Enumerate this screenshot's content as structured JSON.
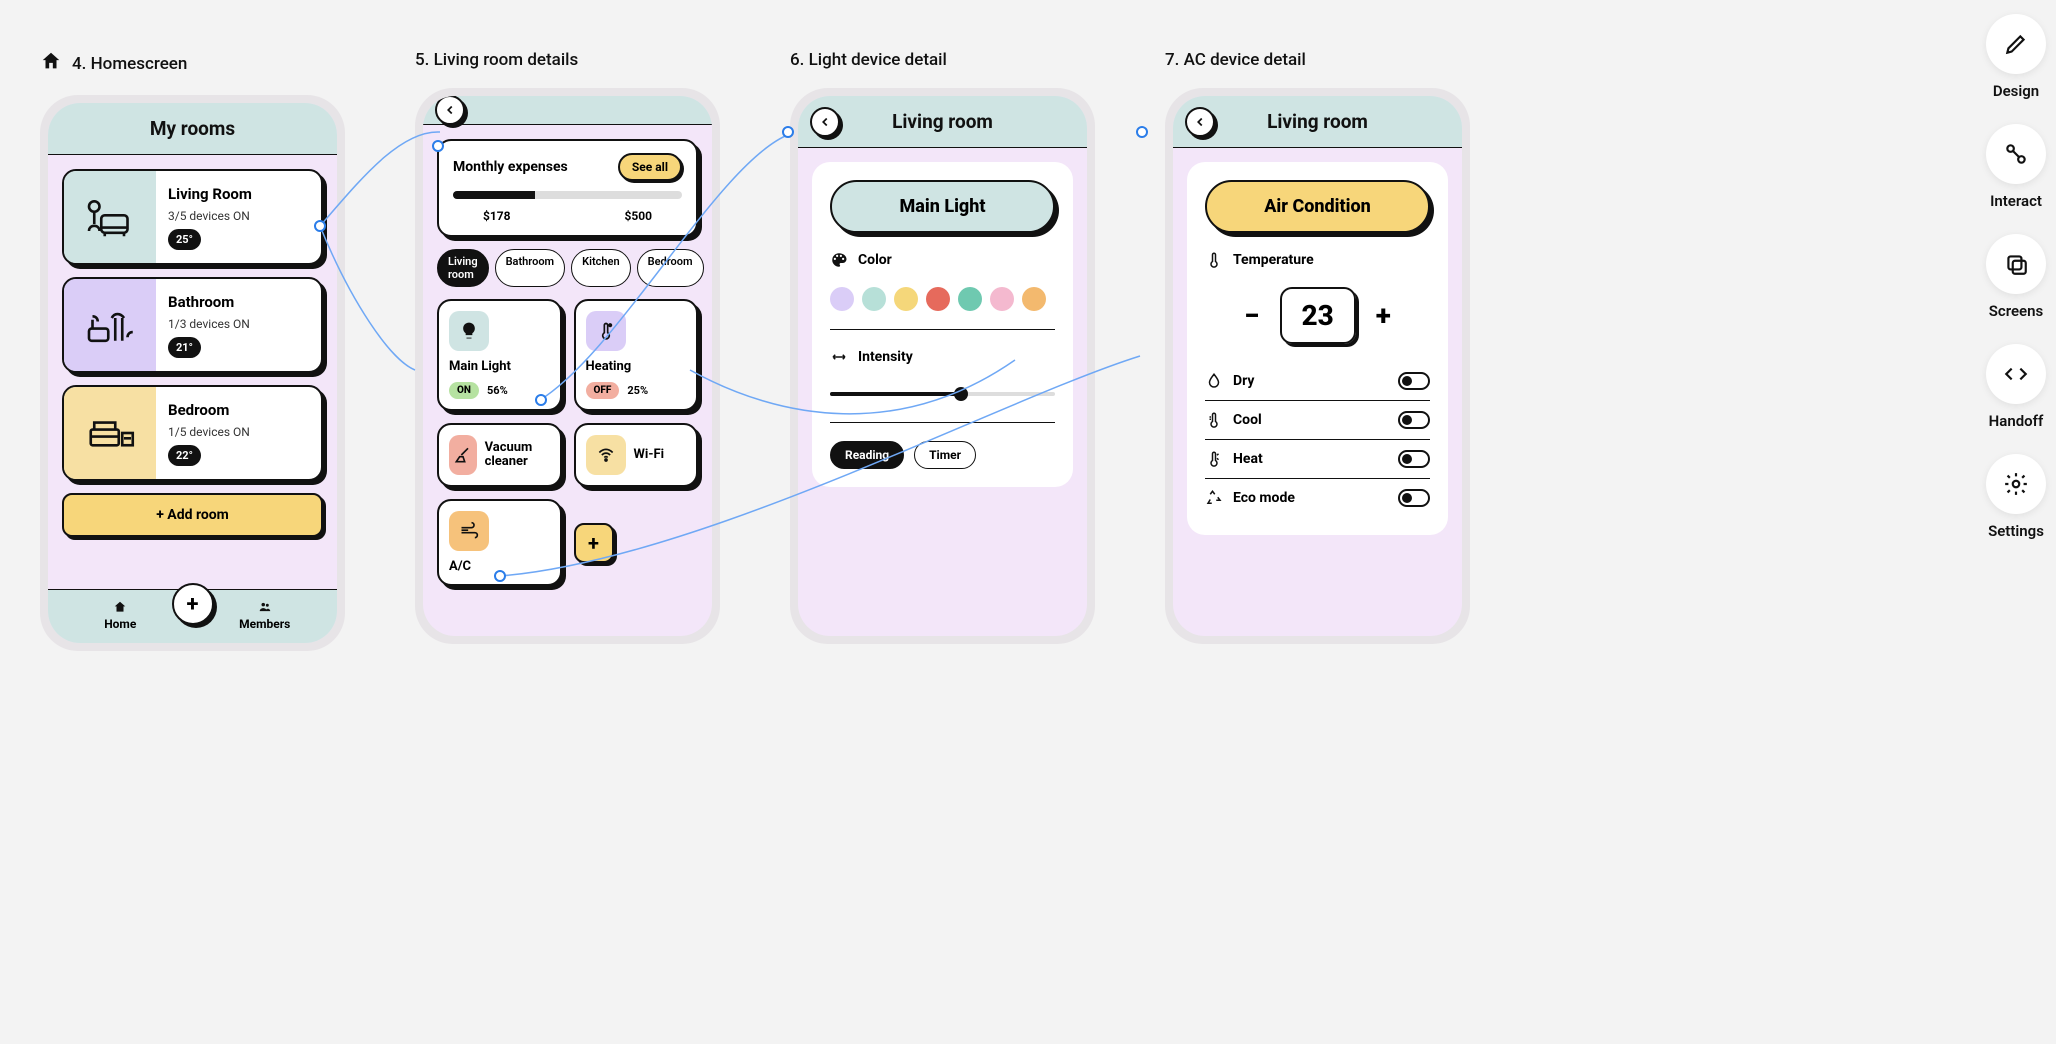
{
  "toolbar": [
    {
      "label": "Design"
    },
    {
      "label": "Interact"
    },
    {
      "label": "Screens"
    },
    {
      "label": "Handoff"
    },
    {
      "label": "Settings"
    }
  ],
  "screens": {
    "home": {
      "label": "4. Homescreen",
      "title": "My rooms",
      "rooms": [
        {
          "name": "Living Room",
          "sub": "3/5 devices ON",
          "temp": "25°"
        },
        {
          "name": "Bathroom",
          "sub": "1/3 devices ON",
          "temp": "21°"
        },
        {
          "name": "Bedroom",
          "sub": "1/5 devices ON",
          "temp": "22°"
        }
      ],
      "add_room": "+ Add room",
      "tabs": {
        "home": "Home",
        "members": "Members"
      }
    },
    "living": {
      "label": "5. Living room details",
      "title": "",
      "expenses": {
        "title": "Monthly expenses",
        "see_all": "See all",
        "spent": "$178",
        "budget": "$500"
      },
      "chips": [
        "Living room",
        "Bathroom",
        "Kitchen",
        "Bedroom"
      ],
      "devices": {
        "main_light": {
          "name": "Main Light",
          "state": "ON",
          "pct": "56%"
        },
        "heating": {
          "name": "Heating",
          "state": "OFF",
          "pct": "25%"
        },
        "vacuum": {
          "name": "Vacuum cleaner"
        },
        "wifi": {
          "name": "Wi-Fi"
        },
        "ac": {
          "name": "A/C"
        }
      }
    },
    "light": {
      "label": "6. Light device detail",
      "header": "Living room",
      "title": "Main Light",
      "color_label": "Color",
      "intensity_label": "Intensity",
      "modes": {
        "reading": "Reading",
        "timer": "Timer"
      },
      "swatches": [
        "#dacdf7",
        "#b7e0d8",
        "#f5d77a",
        "#e66a5c",
        "#6fc9b0",
        "#f4b9cf",
        "#f3b96e"
      ]
    },
    "ac": {
      "label": "7. AC device detail",
      "header": "Living room",
      "title": "Air Condition",
      "temp_label": "Temperature",
      "temp_value": "23",
      "options": {
        "dry": "Dry",
        "cool": "Cool",
        "heat": "Heat",
        "eco": "Eco mode"
      }
    }
  }
}
